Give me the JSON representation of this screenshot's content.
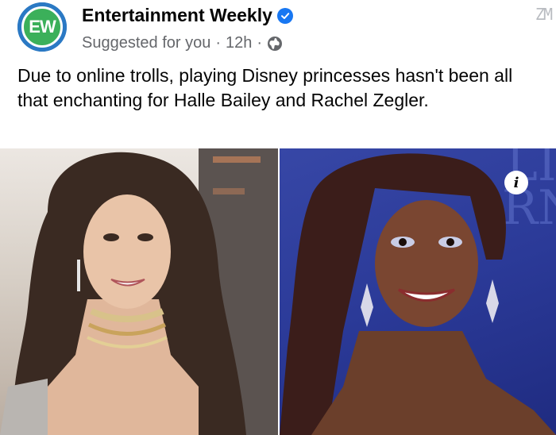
{
  "post": {
    "page_name": "Entertainment Weekly",
    "avatar_text": "EW",
    "suggested": "Suggested for you",
    "time": "12h",
    "separator": "·",
    "caption": "Due to online trolls, playing Disney princesses hasn't been all that enchanting for Halle Bailey and Rachel Zegler.",
    "info_label": "i",
    "watermark": "ZM"
  },
  "colors": {
    "avatar_blue": "#2b79c4",
    "avatar_green": "#3bb05a",
    "verified_blue": "#1877f2",
    "meta_gray": "#65676b"
  },
  "icons": [
    "verified-badge-icon",
    "globe-icon",
    "info-icon"
  ]
}
